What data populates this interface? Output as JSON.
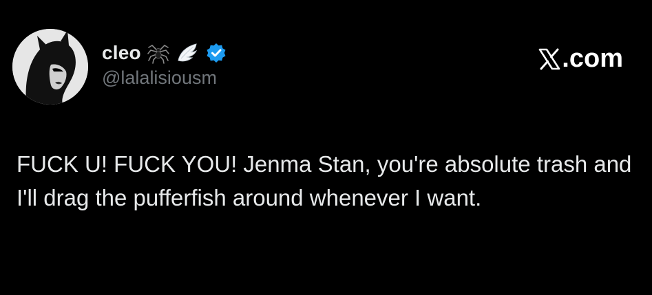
{
  "post": {
    "author": {
      "display_name": "cleo",
      "handle": "@lalalisiousm",
      "emojis": [
        "spider-emoji",
        "wing-emoji"
      ],
      "verified": true,
      "verified_color": "#1d9bf0"
    },
    "brand": {
      "label": ".com"
    },
    "text": "FUCK U! FUCK YOU! Jenma Stan, you're absolute trash and I'll drag the pufferfish around whenever I want."
  },
  "colors": {
    "background": "#000000",
    "text": "#e7e9ea",
    "handle": "#71767b"
  }
}
